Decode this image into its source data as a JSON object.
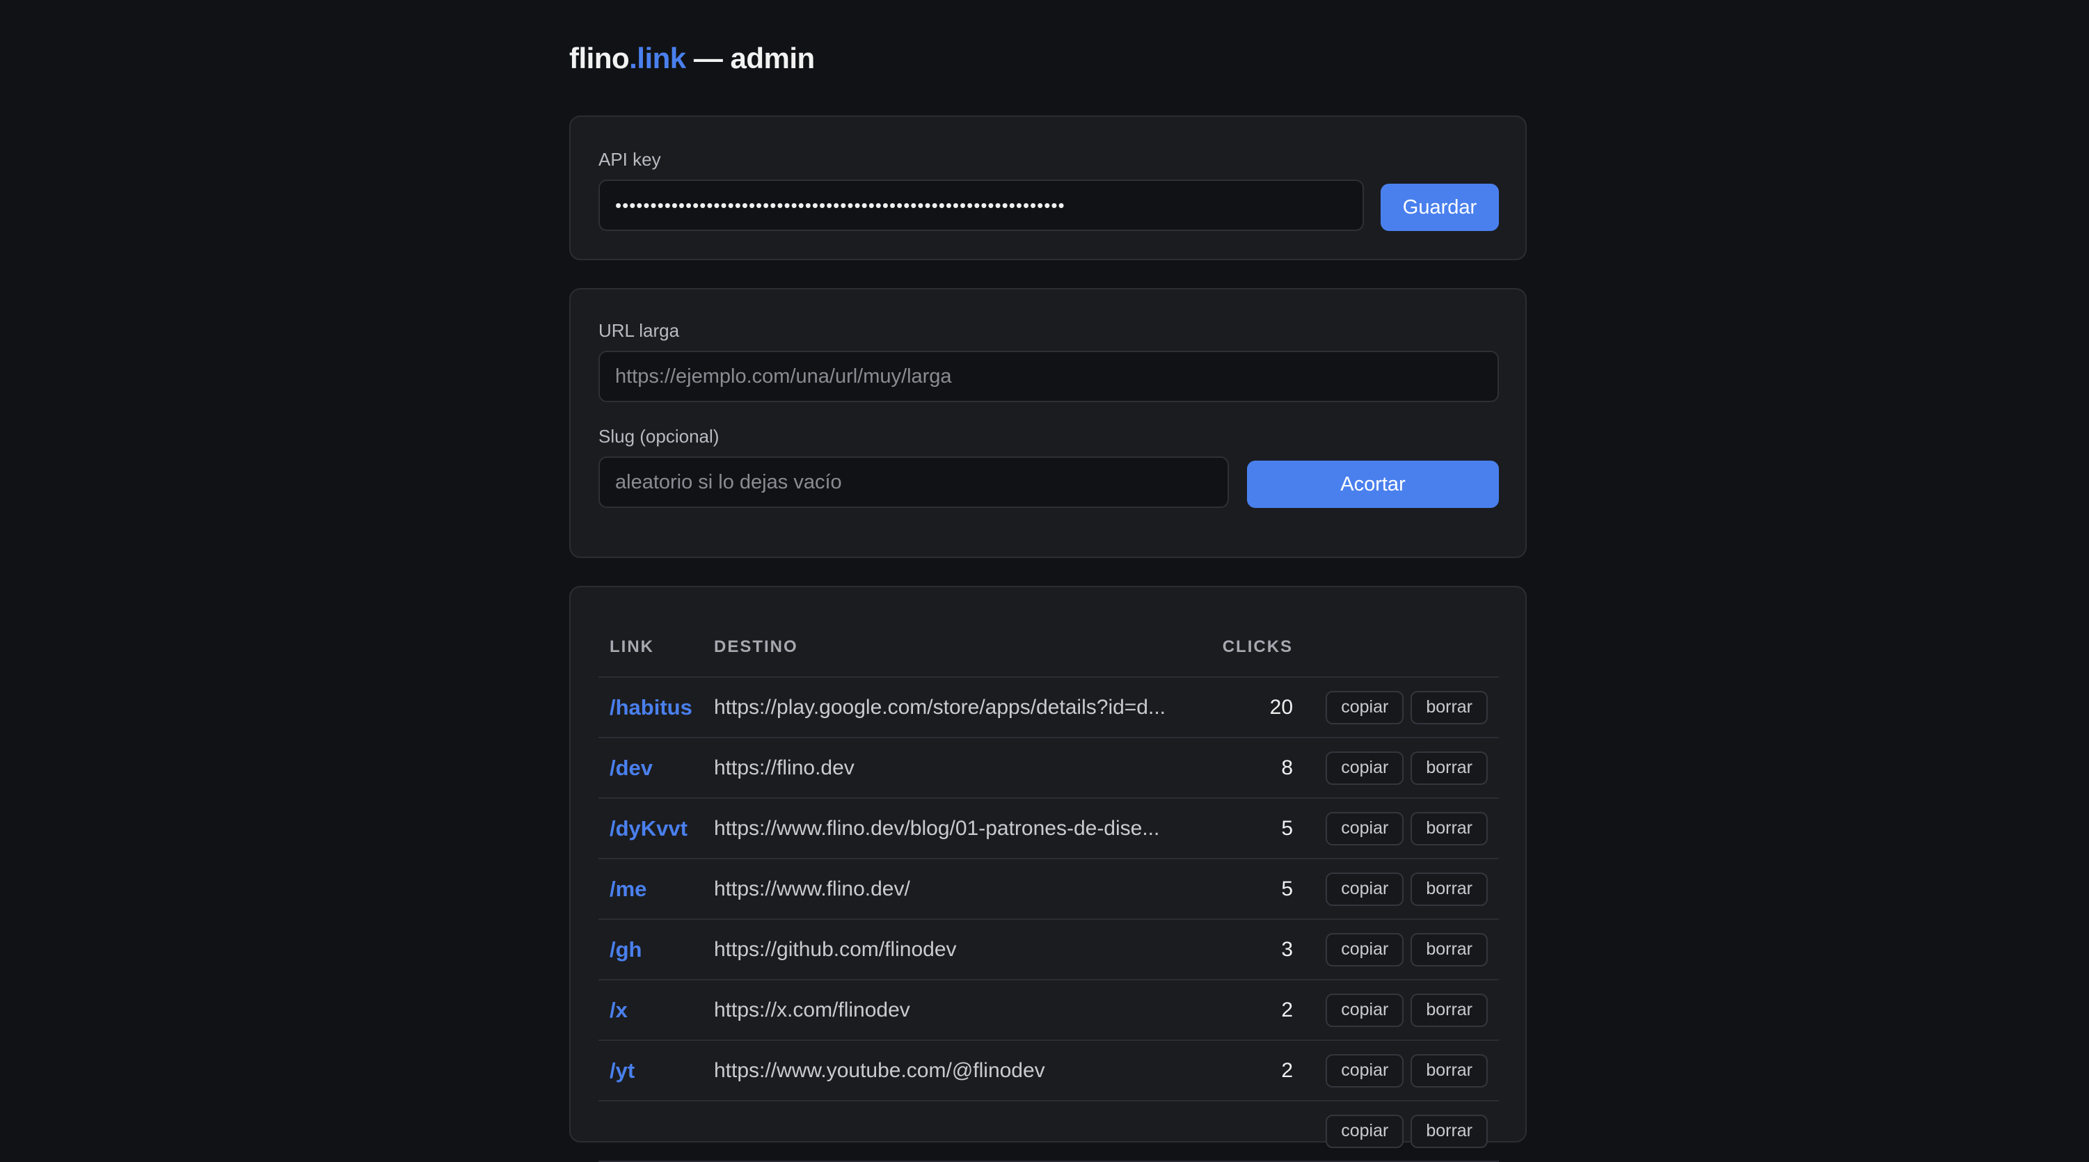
{
  "header": {
    "brand_main": "flino",
    "brand_accent": ".link",
    "brand_suffix": " — admin"
  },
  "api_card": {
    "label": "API key",
    "value": "••••••••••••••••••••••••••••••••••••••••••••••••••••••••••••••••",
    "save_label": "Guardar"
  },
  "shorten_card": {
    "url_label": "URL larga",
    "url_placeholder": "https://ejemplo.com/una/url/muy/larga",
    "slug_label": "Slug (opcional)",
    "slug_placeholder": "aleatorio si lo dejas vacío",
    "shorten_label": "Acortar"
  },
  "links_table": {
    "columns": [
      "LINK",
      "DESTINO",
      "CLICKS",
      ""
    ],
    "copy_label": "copiar",
    "delete_label": "borrar",
    "rows": [
      {
        "slug": "/habitus",
        "dest": "https://play.google.com/store/apps/details?id=d...",
        "clicks": "20"
      },
      {
        "slug": "/dev",
        "dest": "https://flino.dev",
        "clicks": "8"
      },
      {
        "slug": "/dyKvvt",
        "dest": "https://www.flino.dev/blog/01-patrones-de-dise...",
        "clicks": "5"
      },
      {
        "slug": "/me",
        "dest": "https://www.flino.dev/",
        "clicks": "5"
      },
      {
        "slug": "/gh",
        "dest": "https://github.com/flinodev",
        "clicks": "3"
      },
      {
        "slug": "/x",
        "dest": "https://x.com/flinodev",
        "clicks": "2"
      },
      {
        "slug": "/yt",
        "dest": "https://www.youtube.com/@flinodev",
        "clicks": "2"
      },
      {
        "slug": "",
        "dest": "",
        "clicks": ""
      }
    ]
  },
  "colors": {
    "accent": "#4a80ee",
    "background": "#111215",
    "card": "#1b1c20"
  }
}
